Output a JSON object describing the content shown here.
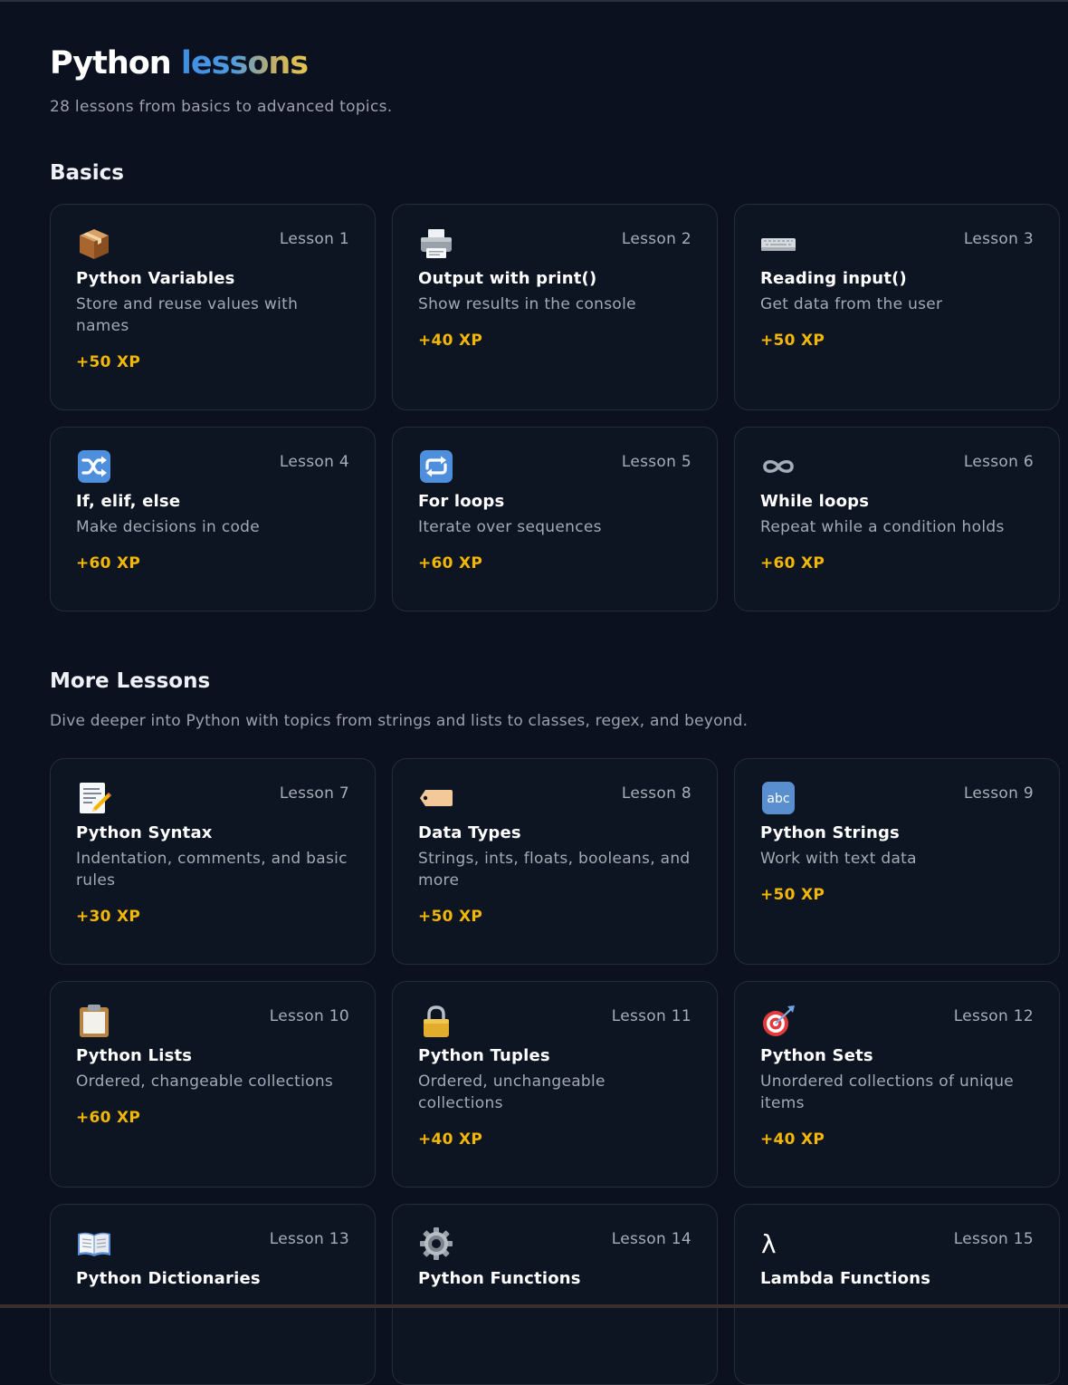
{
  "page": {
    "title_part1": "Python",
    "title_part2": "lessons",
    "subtitle": "28 lessons from basics to advanced topics."
  },
  "sections": {
    "basics": {
      "heading": "Basics"
    },
    "more": {
      "heading": "More Lessons",
      "description": "Dive deeper into Python with topics from strings and lists to classes, regex, and beyond."
    }
  },
  "lessons": [
    {
      "number": "Lesson 1",
      "icon": "package-icon",
      "title": "Python Variables",
      "description": "Store and reuse values with names",
      "xp": "+50 XP"
    },
    {
      "number": "Lesson 2",
      "icon": "printer-icon",
      "title": "Output with print()",
      "description": "Show results in the console",
      "xp": "+40 XP"
    },
    {
      "number": "Lesson 3",
      "icon": "keyboard-icon",
      "title": "Reading input()",
      "description": "Get data from the user",
      "xp": "+50 XP"
    },
    {
      "number": "Lesson 4",
      "icon": "shuffle-icon",
      "title": "If, elif, else",
      "description": "Make decisions in code",
      "xp": "+60 XP"
    },
    {
      "number": "Lesson 5",
      "icon": "repeat-icon",
      "title": "For loops",
      "description": "Iterate over sequences",
      "xp": "+60 XP"
    },
    {
      "number": "Lesson 6",
      "icon": "infinity-icon",
      "title": "While loops",
      "description": "Repeat while a condition holds",
      "xp": "+60 XP"
    },
    {
      "number": "Lesson 7",
      "icon": "memo-icon",
      "title": "Python Syntax",
      "description": "Indentation, comments, and basic rules",
      "xp": "+30 XP"
    },
    {
      "number": "Lesson 8",
      "icon": "label-tag-icon",
      "title": "Data Types",
      "description": "Strings, ints, floats, booleans, and more",
      "xp": "+50 XP"
    },
    {
      "number": "Lesson 9",
      "icon": "abc-icon",
      "abc_text": "abc",
      "title": "Python Strings",
      "description": "Work with text data",
      "xp": "+50 XP"
    },
    {
      "number": "Lesson 10",
      "icon": "clipboard-icon",
      "title": "Python Lists",
      "description": "Ordered, changeable collections",
      "xp": "+60 XP"
    },
    {
      "number": "Lesson 11",
      "icon": "lock-icon",
      "title": "Python Tuples",
      "description": "Ordered, unchangeable collections",
      "xp": "+40 XP"
    },
    {
      "number": "Lesson 12",
      "icon": "target-icon",
      "title": "Python Sets",
      "description": "Unordered collections of unique items",
      "xp": "+40 XP"
    },
    {
      "number": "Lesson 13",
      "icon": "book-icon",
      "title": "Python Dictionaries",
      "description": "",
      "xp": ""
    },
    {
      "number": "Lesson 14",
      "icon": "gear-icon",
      "title": "Python Functions",
      "description": "",
      "xp": ""
    },
    {
      "number": "Lesson 15",
      "icon": "lambda-icon",
      "lambda_text": "λ",
      "title": "Lambda Functions",
      "description": "",
      "xp": ""
    }
  ],
  "colors": {
    "background": "#0b111e",
    "card": "#0d1422",
    "card_border": "#262d3a",
    "xp": "#f2b705",
    "title_gradient_start": "#3f8ee6",
    "title_gradient_end": "#e3c54e"
  }
}
